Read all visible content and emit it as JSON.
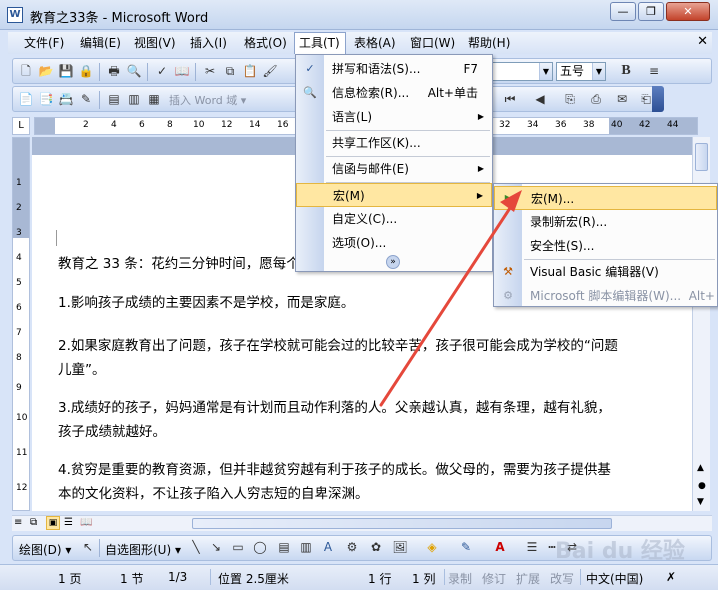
{
  "window": {
    "title": "教育之33条 - Microsoft Word",
    "doc_icon": "W",
    "minimize": "—",
    "restore": "❐",
    "close": "✕"
  },
  "menubar": {
    "items": [
      "文件(F)",
      "编辑(E)",
      "视图(V)",
      "插入(I)",
      "格式(O)",
      "工具(T)",
      "表格(A)",
      "窗口(W)",
      "帮助(H)"
    ],
    "active": "工具(T)",
    "close_glyph": "✕"
  },
  "toolbar": {
    "font_size": "五号",
    "bold": "B",
    "insert_field": "插入 Word 域 ▾"
  },
  "ruler": {
    "numbers": [
      "2",
      "4",
      "6",
      "8",
      "10",
      "12",
      "14",
      "16",
      "32",
      "34",
      "36",
      "38",
      "40",
      "42",
      "44"
    ]
  },
  "vruler": {
    "numbers": [
      "1",
      "2",
      "3",
      "4",
      "5",
      "6",
      "7",
      "8",
      "9",
      "10",
      "11",
      "12"
    ]
  },
  "document": {
    "paragraphs": [
      "教育之 33 条：花约三分钟时间，愿每个",
      "1.影响孩子成绩的主要因素不是学校，而是家庭。",
      "2.如果家庭教育出了问题，孩子在学校就可能会过的比较辛苦，孩子很可能会成为学校的“问题儿童”。",
      "3.成绩好的孩子，妈妈通常是有计划而且动作利落的人。父亲越认真，越有条理，越有礼貌，孩子成绩就越好。",
      "4.贫穷是重要的教育资源，但并非越贫穷越有利于孩子的成长。做父母的，需要为孩子提供基本的文化资料，不让孩子陷入人穷志短的自卑深渊。"
    ]
  },
  "tools_menu": {
    "items": [
      {
        "label": "拼写和语法(S)...",
        "shortcut": "F7",
        "icon": "spellcheck-icon"
      },
      {
        "label": "信息检索(R)...",
        "shortcut": "Alt+单击",
        "icon": "research-icon"
      },
      {
        "label": "语言(L)",
        "submenu": true
      },
      {
        "label": "共享工作区(K)..."
      },
      {
        "label": "信函与邮件(E)",
        "submenu": true
      },
      {
        "label": "宏(M)",
        "submenu": true,
        "highlighted": true
      },
      {
        "label": "自定义(C)..."
      },
      {
        "label": "选项(O)..."
      }
    ],
    "expand": "»"
  },
  "macro_submenu": {
    "items": [
      {
        "label": "宏(M)...",
        "highlighted": true,
        "icon": "play-icon"
      },
      {
        "label": "录制新宏(R)..."
      },
      {
        "label": "安全性(S)..."
      },
      {
        "label": "Visual Basic 编辑器(V)",
        "icon": "vba-editor-icon"
      },
      {
        "label": "Microsoft 脚本编辑器(W)...",
        "shortcut": "Alt+",
        "disabled": true,
        "icon": "script-editor-icon"
      }
    ]
  },
  "drawbar": {
    "draw": "绘图(D) ▾",
    "autoshapes": "自选图形(U) ▾"
  },
  "statusbar": {
    "page": "1 页",
    "section": "1 节",
    "page_of": "1/3",
    "position": "位置 2.5厘米",
    "line": "1 行",
    "column": "1 列",
    "rec": "录制",
    "trk": "修订",
    "ext": "扩展",
    "ovr": "改写",
    "language": "中文(中国)"
  },
  "colors": {
    "arrow": "#e5483b",
    "highlight": "#ffe7a2"
  }
}
